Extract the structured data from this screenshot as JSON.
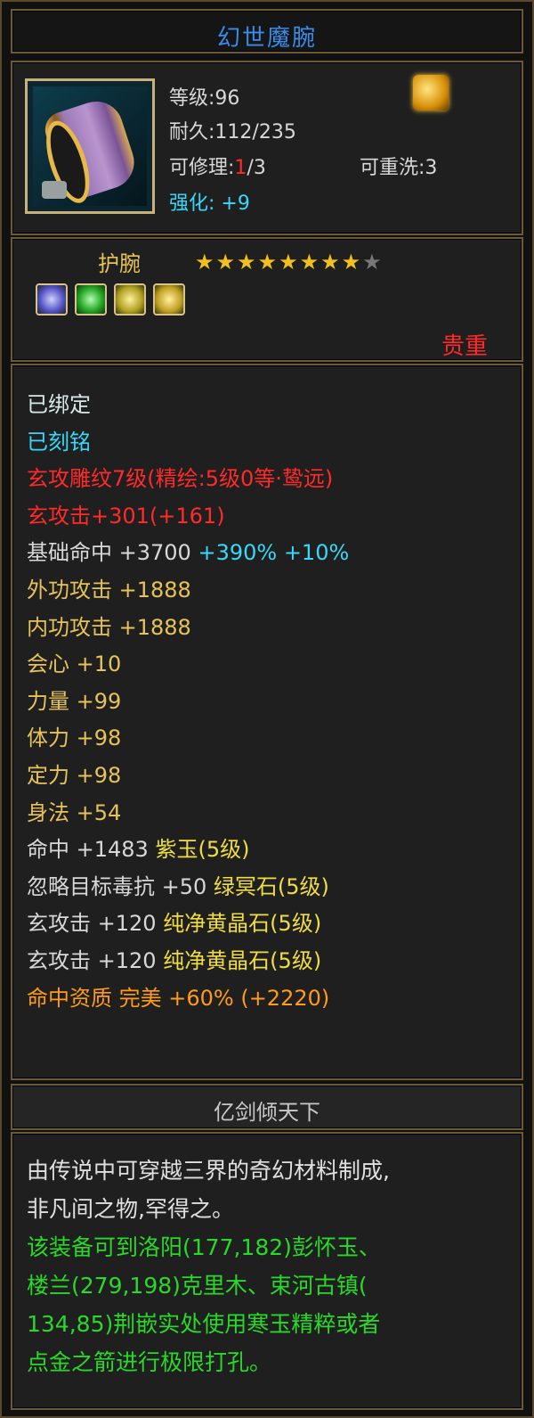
{
  "title": "幻世魔腕",
  "info": {
    "level_label": "等级",
    "level_value": ":96",
    "durability_label": "耐久",
    "durability_value": ":112/235",
    "repair_label": "可修理:",
    "repair_current": "1",
    "repair_max": "/3",
    "rewash_label": "可重洗",
    "rewash_value": ":3",
    "enhance_label": "强化:",
    "enhance_value": "+9"
  },
  "type": {
    "name": "护腕",
    "stars_filled": 8,
    "stars_total": 9,
    "precious": "贵重"
  },
  "attributes": [
    {
      "text": "已绑定",
      "color": "white"
    },
    {
      "text": "已刻铭",
      "color": "cyan"
    },
    {
      "text": "玄攻雕纹7级(精绘:5级0等·鸷远)",
      "color": "red"
    },
    {
      "text": "玄攻击+301(+161)",
      "color": "red"
    },
    {
      "text": "基础命中 +3700 ",
      "extra1": "+390% ",
      "extra2": "+10%",
      "color": "white"
    },
    {
      "text": "外功攻击 +1888",
      "color": "gold"
    },
    {
      "text": "内功攻击 +1888",
      "color": "gold"
    },
    {
      "text": "会心 +10",
      "color": "gold"
    },
    {
      "text": "力量 +99",
      "color": "gold"
    },
    {
      "text": "体力 +98",
      "color": "gold"
    },
    {
      "text": "定力 +98",
      "color": "gold"
    },
    {
      "text": "身法 +54",
      "color": "gold"
    },
    {
      "text": "命中 +1483 ",
      "gem": "紫玉(5级)",
      "color": "white"
    },
    {
      "text": "忽略目标毒抗 +50 ",
      "gem": "绿冥石(5级)",
      "color": "white"
    },
    {
      "text": "玄攻击 +120 ",
      "gem": "纯净黄晶石(5级)",
      "color": "white"
    },
    {
      "text": "玄攻击 +120 ",
      "gem": "纯净黄晶石(5级)",
      "color": "white"
    },
    {
      "text": "命中资质  完美 +60% (+2220)",
      "color": "orange"
    }
  ],
  "signature": "亿剑倾天下",
  "description": {
    "lines_white": [
      "由传说中可穿越三界的奇幻材料制成,",
      "非凡间之物,罕得之。"
    ],
    "lines_green": [
      "该装备可到洛阳(177,182)彭怀玉、",
      "楼兰(279,198)克里木、束河古镇(",
      "134,85)荆嵌实处使用寒玉精粹或者",
      "点金之箭进行极限打孔。"
    ]
  },
  "colors": {
    "title": "#3a8ce8",
    "red": "#ff2a2a",
    "cyan": "#38d8f8",
    "gold": "#e6c35a",
    "green": "#2ad82a",
    "orange": "#ff9b1a",
    "border": "#6b5a34"
  },
  "icons": [
    "wristguard-item-icon",
    "bind-lock-icon",
    "skill-flame-icon",
    "star-icon",
    "gem-purple-icon",
    "gem-green-icon",
    "gem-yellow-icon"
  ]
}
